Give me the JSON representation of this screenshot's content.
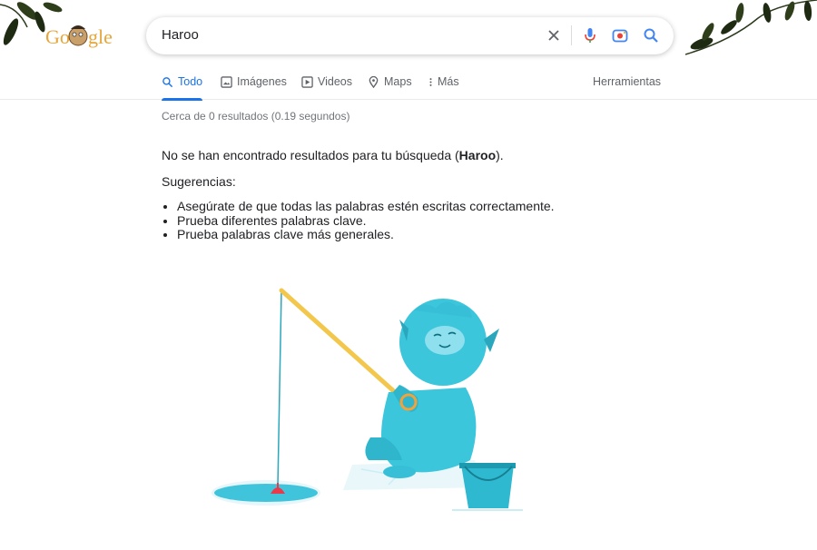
{
  "logo": {
    "text": "Google"
  },
  "search": {
    "query": "Haroo"
  },
  "tabs": [
    {
      "label": "Todo",
      "icon": "search-icon",
      "active": true
    },
    {
      "label": "Imágenes",
      "icon": "image-icon"
    },
    {
      "label": "Videos",
      "icon": "video-icon"
    },
    {
      "label": "Maps",
      "icon": "map-pin-icon"
    },
    {
      "label": "Más",
      "icon": "more-vert-icon"
    }
  ],
  "tools_label": "Herramientas",
  "stats": "Cerca de 0 resultados (0.19 segundos)",
  "no_results": {
    "prefix": "No se han encontrado resultados para tu búsqueda (",
    "query": "Haroo",
    "suffix": ")."
  },
  "suggestions": {
    "title": "Sugerencias:",
    "items": [
      "Asegúrate de que todas las palabras estén escritas correctamente.",
      "Prueba diferentes palabras clave.",
      "Prueba palabras clave más generales."
    ]
  },
  "colors": {
    "accent": "#1a73e8",
    "logo": "#e6a63a",
    "monster": "#3cc6dc",
    "rod": "#f2c74b"
  }
}
